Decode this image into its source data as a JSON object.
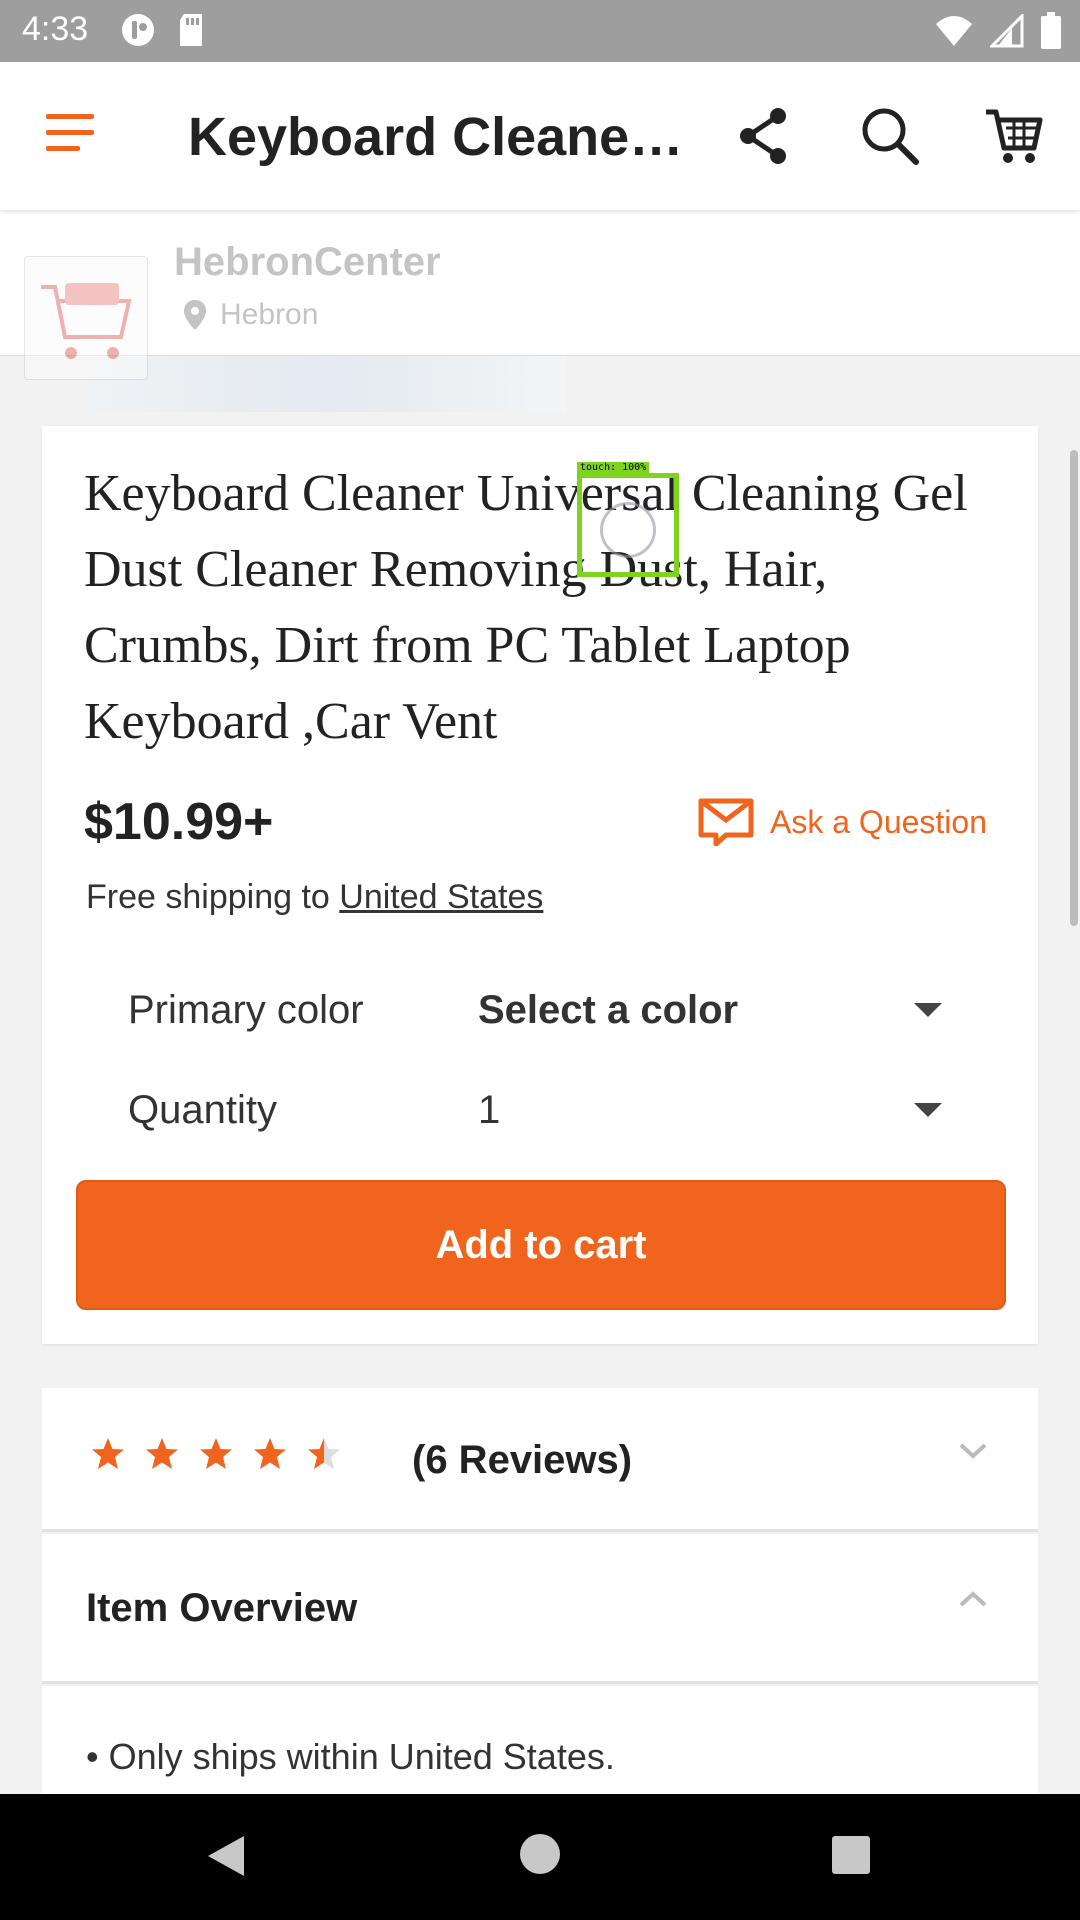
{
  "status_bar": {
    "time": "4:33",
    "left_icons": [
      "notification-icon",
      "sd-card-icon"
    ],
    "right_icons": [
      "wifi-icon",
      "signal-icon",
      "battery-icon"
    ]
  },
  "app_bar": {
    "title": "Keyboard Cleane…",
    "icons": [
      "menu-icon",
      "share-icon",
      "search-icon",
      "cart-icon"
    ]
  },
  "shop": {
    "name": "HebronCenter",
    "location": "Hebron"
  },
  "product": {
    "title": "Keyboard Cleaner Universal Cleaning Gel Dust Cleaner Removing Dust, Hair, Crumbs, Dirt from PC Tablet Laptop Keyboard ,Car Vent",
    "price": "$10.99+",
    "ask_question_label": "Ask a Question",
    "shipping_prefix": "Free shipping to ",
    "shipping_destination": "United States",
    "options": [
      {
        "label": "Primary color",
        "value": "Select a color"
      },
      {
        "label": "Quantity",
        "value": "1"
      }
    ],
    "add_to_cart_label": "Add to cart"
  },
  "reviews": {
    "rating": 4.5,
    "max_rating": 5,
    "count_label": "(6 Reviews)"
  },
  "item_overview": {
    "title": "Item Overview",
    "bullets": [
      "• Only ships within United States."
    ]
  },
  "touch_indicator": {
    "label": "touch: 100%"
  },
  "colors": {
    "accent": "#f1641e",
    "status_bar": "#9e9e9e",
    "nav_bar": "#000000",
    "touch_box": "#7ed321"
  }
}
